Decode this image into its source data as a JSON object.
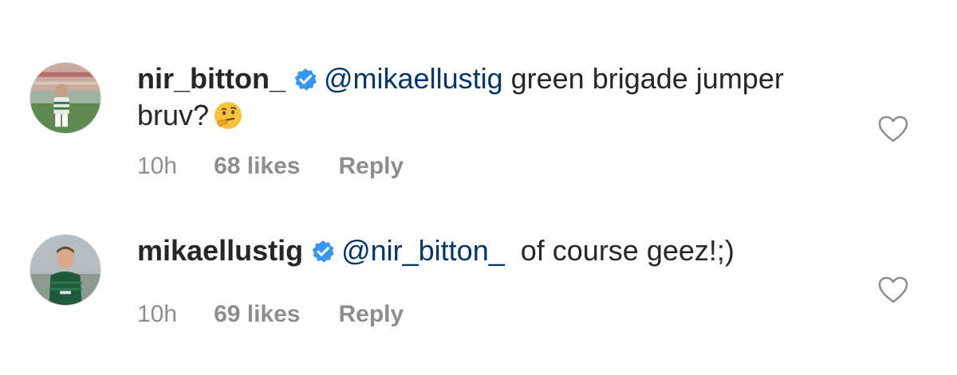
{
  "comments": [
    {
      "username": "nir_bitton_",
      "verified": true,
      "mention": "@mikaellustig",
      "text": " green brigade jumper bruv?",
      "emoji": "thinking-face",
      "time": "10h",
      "likes": "68 likes",
      "reply": "Reply",
      "avatar_icon": "player-avatar-white-kit"
    },
    {
      "username": "mikaellustig",
      "verified": true,
      "mention": "@nir_bitton_",
      "text": "  of course geez!;)",
      "time": "10h",
      "likes": "69 likes",
      "reply": "Reply",
      "avatar_icon": "player-avatar-green-kit"
    }
  ],
  "colors": {
    "verified_badge": "#3897f0",
    "mention": "#003569",
    "meta": "#8e8e8e",
    "text": "#262626"
  }
}
